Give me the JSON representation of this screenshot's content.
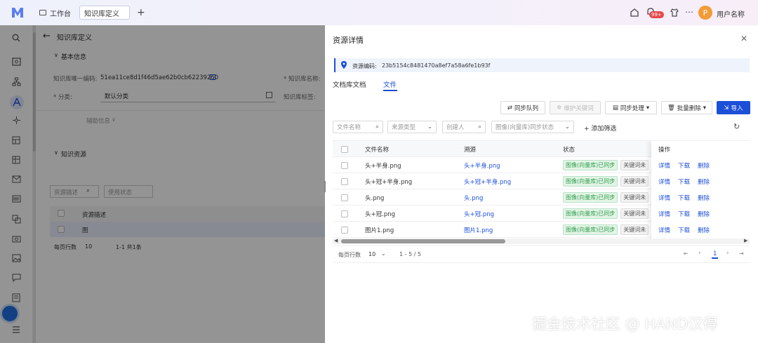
{
  "header": {
    "tabs": [
      {
        "label": "工作台"
      },
      {
        "label": "知识库定义"
      }
    ],
    "notification_badge": "99+",
    "avatar_letter": "P",
    "user_name": "用户名称"
  },
  "left_panel": {
    "back_title": "知识库定义",
    "section_basic": "基本信息",
    "kb_code_label": "知识库唯一编码:",
    "kb_code_value": "51ea11ce8d1f46d5ae62b0cb62239260",
    "kb_name_label": "* 知识库名称:",
    "category_label": "* 分类:",
    "category_value": "默认分类",
    "kb_tag_label": "知识库标签:",
    "aux_info": "辅助信息",
    "section_resources": "知识资源",
    "search_placeholder": "资源描述",
    "status_placeholder": "使用状态",
    "table_header": "资源描述",
    "table_row": "图",
    "pager_label": "每页行数",
    "pager_size": "10",
    "pager_range": "1-1 共1条"
  },
  "drawer": {
    "title": "资源详情",
    "resource_code_label": "资源编码:",
    "resource_code_value": "23b5154c8481470a8ef7a58a6fe1b93f",
    "tabs": [
      {
        "label": "文档库文档"
      },
      {
        "label": "文件"
      }
    ],
    "actions": {
      "sync_queue": "同步队列",
      "maintain_keywords": "维护关键词",
      "sync_process": "同步处理",
      "batch_delete": "批量删除",
      "import": "导入"
    },
    "filters": {
      "file_name": "文件名称",
      "source_type": "来源类型",
      "creator": "创建人",
      "sync_status": "图像(向量库)同步状态",
      "add_filter": "添加筛选"
    },
    "columns": {
      "file_name": "文件名称",
      "source": "溯源",
      "status": "状态",
      "ops": "操作"
    },
    "rows": [
      {
        "file_name": "头+半身.png",
        "source": "头+半身.png",
        "status": "图像(向量库)已同步",
        "status2": "关键词未"
      },
      {
        "file_name": "头+冠+半身.png",
        "source": "头+冠+半身.png",
        "status": "图像(向量库)已同步",
        "status2": "关键词未"
      },
      {
        "file_name": "头.png",
        "source": "头.png",
        "status": "图像(向量库)已同步",
        "status2": "关键词未"
      },
      {
        "file_name": "头+冠.png",
        "source": "头+冠.png",
        "status": "图像(向量库)已同步",
        "status2": "关键词未"
      },
      {
        "file_name": "图片1.png",
        "source": "图片1.png",
        "status": "图像(向量库)已同步",
        "status2": "关键词未"
      }
    ],
    "row_ops": {
      "detail": "详情",
      "download": "下载",
      "delete": "删除"
    },
    "pager": {
      "label": "每页行数",
      "size": "10",
      "range": "1 - 5 / 5",
      "current_page": "1"
    }
  },
  "watermark": "掘金技术社区 @ HAND汉得",
  "colors": {
    "primary": "#1b4fd8",
    "success_bg": "#e3f4e7",
    "success_text": "#2f9e4a",
    "avatar": "#f29b38",
    "badge": "#e5484d"
  }
}
